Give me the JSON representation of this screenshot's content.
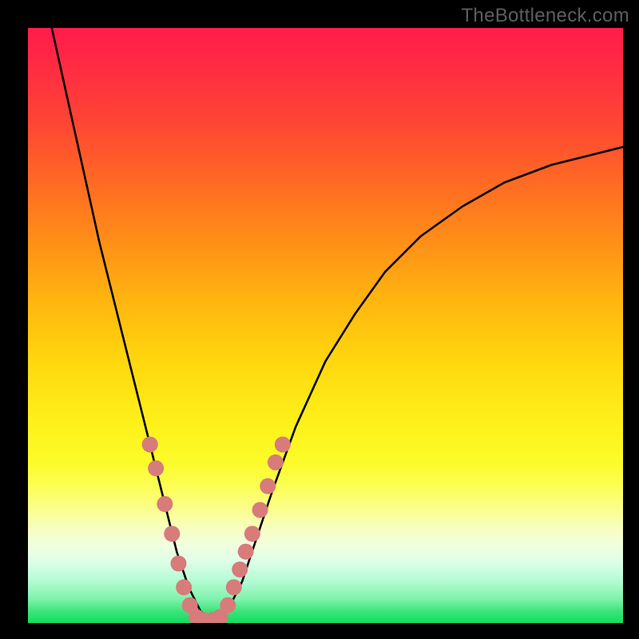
{
  "watermark": "TheBottleneck.com",
  "chart_data": {
    "type": "line",
    "title": "",
    "xlabel": "",
    "ylabel": "",
    "xlim": [
      0,
      100
    ],
    "ylim": [
      0,
      100
    ],
    "grid": false,
    "series": [
      {
        "name": "bottleneck-curve",
        "color": "#000000",
        "x": [
          4,
          6,
          8,
          10,
          12,
          14,
          16,
          18,
          20,
          22,
          24,
          25,
          26,
          27,
          28,
          29,
          30,
          32,
          34,
          36,
          38,
          41,
          45,
          50,
          55,
          60,
          66,
          73,
          80,
          88,
          96,
          100
        ],
        "values": [
          100,
          91,
          82,
          73,
          64,
          56,
          48,
          40,
          32,
          24,
          16,
          12,
          9,
          6,
          4,
          2,
          1,
          1,
          3,
          7,
          13,
          22,
          33,
          44,
          52,
          59,
          65,
          70,
          74,
          77,
          79,
          80
        ]
      }
    ],
    "markers": [
      {
        "name": "curve-dots",
        "color": "#d77b7b",
        "radius_px": 10,
        "points": [
          {
            "x": 20.5,
            "y": 30
          },
          {
            "x": 21.5,
            "y": 26
          },
          {
            "x": 23.0,
            "y": 20
          },
          {
            "x": 24.2,
            "y": 15
          },
          {
            "x": 25.3,
            "y": 10
          },
          {
            "x": 26.2,
            "y": 6
          },
          {
            "x": 27.2,
            "y": 3
          },
          {
            "x": 28.3,
            "y": 1
          },
          {
            "x": 29.6,
            "y": 0.5
          },
          {
            "x": 31.0,
            "y": 0.5
          },
          {
            "x": 32.3,
            "y": 1
          },
          {
            "x": 33.6,
            "y": 3
          },
          {
            "x": 34.6,
            "y": 6
          },
          {
            "x": 35.6,
            "y": 9
          },
          {
            "x": 36.6,
            "y": 12
          },
          {
            "x": 37.7,
            "y": 15
          },
          {
            "x": 39.0,
            "y": 19
          },
          {
            "x": 40.3,
            "y": 23
          },
          {
            "x": 41.6,
            "y": 27
          },
          {
            "x": 42.8,
            "y": 30
          }
        ]
      }
    ],
    "background_gradient": [
      {
        "stop": 0.0,
        "color": "#ff1d4c"
      },
      {
        "stop": 0.5,
        "color": "#ffc70e"
      },
      {
        "stop": 0.8,
        "color": "#fcfe70"
      },
      {
        "stop": 1.0,
        "color": "#12dd5d"
      }
    ]
  }
}
